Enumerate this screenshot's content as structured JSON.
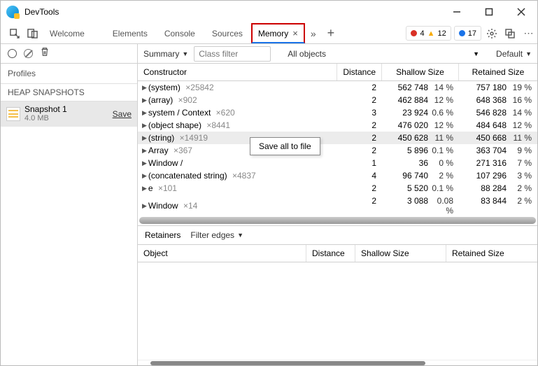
{
  "title": "DevTools",
  "tabs": {
    "t0": "Welcome",
    "t1": "Elements",
    "t2": "Console",
    "t3": "Sources",
    "t4": "Memory"
  },
  "status": {
    "errors": "4",
    "warnings": "12",
    "info": "17"
  },
  "toolbar": {
    "summary": "Summary",
    "filter_placeholder": "Class filter",
    "scope": "All objects",
    "group": "Default"
  },
  "sidebar": {
    "profiles": "Profiles",
    "heap": "HEAP SNAPSHOTS",
    "snapshot_name": "Snapshot 1",
    "snapshot_size": "4.0 MB",
    "save": "Save"
  },
  "headers": {
    "constructor": "Constructor",
    "distance": "Distance",
    "shallow": "Shallow Size",
    "retained": "Retained Size"
  },
  "rows": [
    {
      "name": "(system)",
      "mult": "×25842",
      "dist": "2",
      "sh": "562 748",
      "shp": "14 %",
      "rt": "757 180",
      "rtp": "19 %"
    },
    {
      "name": "(array)",
      "mult": "×902",
      "dist": "2",
      "sh": "462 884",
      "shp": "12 %",
      "rt": "648 368",
      "rtp": "16 %"
    },
    {
      "name": "system / Context",
      "mult": "×620",
      "dist": "3",
      "sh": "23 924",
      "shp": "0.6 %",
      "rt": "546 828",
      "rtp": "14 %"
    },
    {
      "name": "(object shape)",
      "mult": "×8441",
      "dist": "2",
      "sh": "476 020",
      "shp": "12 %",
      "rt": "484 648",
      "rtp": "12 %"
    },
    {
      "name": "(string)",
      "mult": "×14919",
      "dist": "2",
      "sh": "450 628",
      "shp": "11 %",
      "rt": "450 668",
      "rtp": "11 %"
    },
    {
      "name": "Array",
      "mult": "×367",
      "dist": "2",
      "sh": "5 896",
      "shp": "0.1 %",
      "rt": "363 704",
      "rtp": "9 %"
    },
    {
      "name": "Window /",
      "mult": "",
      "dist": "1",
      "sh": "36",
      "shp": "0 %",
      "rt": "271 316",
      "rtp": "7 %"
    },
    {
      "name": "(concatenated string)",
      "mult": "×4837",
      "dist": "4",
      "sh": "96 740",
      "shp": "2 %",
      "rt": "107 296",
      "rtp": "3 %"
    },
    {
      "name": "e",
      "mult": "×101",
      "dist": "2",
      "sh": "5 520",
      "shp": "0.1 %",
      "rt": "88 284",
      "rtp": "2 %"
    },
    {
      "name": "Window",
      "mult": "×14",
      "dist": "2",
      "sh": "3 088",
      "shp": "0.08 %",
      "rt": "83 844",
      "rtp": "2 %"
    }
  ],
  "context_menu": "Save all to file",
  "retainers": {
    "label": "Retainers",
    "filter": "Filter edges"
  },
  "ret_headers": {
    "object": "Object",
    "distance": "Distance",
    "shallow": "Shallow Size",
    "retained": "Retained Size"
  }
}
